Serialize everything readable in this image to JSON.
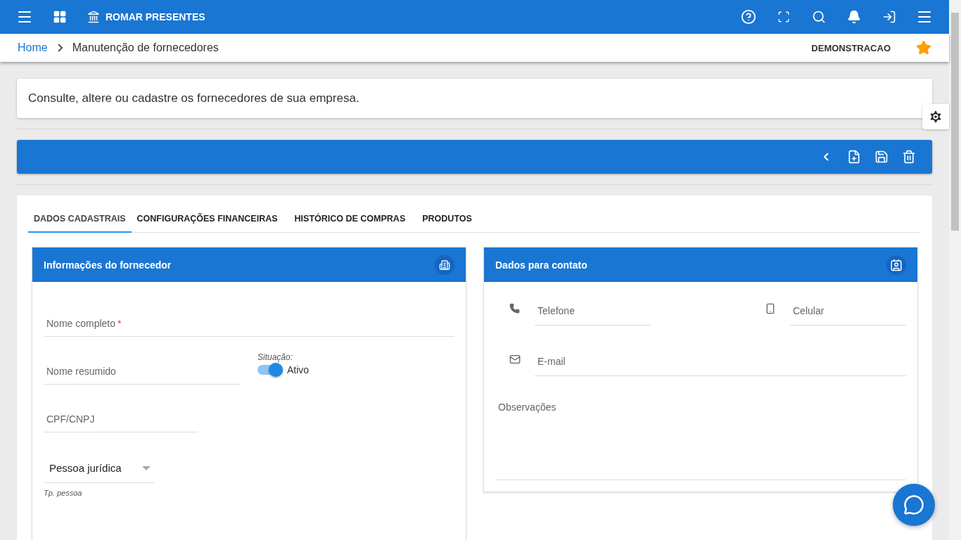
{
  "header": {
    "title": "ROMAR PRESENTES"
  },
  "breadcrumb": {
    "home": "Home",
    "current": "Manutenção de fornecedores",
    "company": "DEMONSTRACAO",
    "favorite": true
  },
  "intro": "Consulte, altere ou cadastre os fornecedores de sua empresa.",
  "tabs": [
    {
      "label": "DADOS CADASTRAIS",
      "selected": true
    },
    {
      "label": "CONFIGURAÇÕES FINANCEIRAS",
      "selected": false
    },
    {
      "label": "HISTÓRICO DE COMPRAS",
      "selected": false
    },
    {
      "label": "PRODUTOS",
      "selected": false
    }
  ],
  "supplier_panel": {
    "title": "Informações do fornecedor",
    "full_name": {
      "placeholder": "Nome completo",
      "required_mark": "*"
    },
    "short_name": {
      "placeholder": "Nome resumido"
    },
    "status": {
      "label": "Situação:",
      "on": true,
      "text": "Ativo"
    },
    "document": {
      "placeholder": "CPF/CNPJ"
    },
    "person_type": {
      "value": "Pessoa jurídica",
      "hint": "Tp. pessoa"
    }
  },
  "contact_panel": {
    "title": "Dados para contato",
    "phone": {
      "placeholder": "Telefone"
    },
    "mobile": {
      "placeholder": "Celular"
    },
    "email": {
      "placeholder": "E-mail"
    },
    "notes": {
      "placeholder": "Observações"
    }
  }
}
